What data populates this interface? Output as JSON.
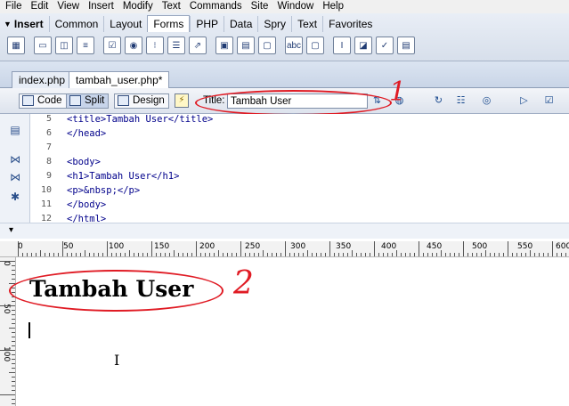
{
  "menu": [
    "File",
    "Edit",
    "View",
    "Insert",
    "Modify",
    "Text",
    "Commands",
    "Site",
    "Window",
    "Help"
  ],
  "insert_bar": {
    "label": "Insert",
    "tabs": [
      {
        "label": "Common",
        "active": false
      },
      {
        "label": "Layout",
        "active": false
      },
      {
        "label": "Forms",
        "active": true
      },
      {
        "label": "PHP",
        "active": false
      },
      {
        "label": "Data",
        "active": false
      },
      {
        "label": "Spry",
        "active": false
      },
      {
        "label": "Text",
        "active": false
      },
      {
        "label": "Favorites",
        "active": false
      }
    ],
    "icon_names": [
      "form-icon",
      "text-field-icon",
      "hidden-field-icon",
      "textarea-icon",
      "checkbox-icon",
      "radio-button-icon",
      "radio-group-icon",
      "list-menu-icon",
      "jump-menu-icon",
      "image-field-icon",
      "file-field-icon",
      "button-icon",
      "label-icon",
      "fieldset-icon",
      "spry-textfield-icon",
      "spry-select-icon",
      "spry-checkbox-icon",
      "spry-textarea-icon"
    ]
  },
  "doc_tabs": [
    "index.php",
    "tambah_user.php*"
  ],
  "doc_toolbar": {
    "view_buttons": [
      "Code",
      "Split",
      "Design"
    ],
    "active_view": "Split",
    "title_label": "Title:",
    "title_value": "Tambah User"
  },
  "code": {
    "line_numbers": [
      "5",
      "6",
      "7",
      "8",
      "9",
      "10",
      "11",
      "12"
    ],
    "lines": [
      "<title>Tambah User</title>",
      "</head>",
      "",
      "<body>",
      "<h1>Tambah User</h1>",
      "<p>&nbsp;</p>",
      "</body>",
      "</html>"
    ]
  },
  "ruler": {
    "top_labels": [
      "0",
      "50",
      "100",
      "150",
      "200",
      "250",
      "300",
      "350",
      "400",
      "450",
      "500",
      "550",
      "600"
    ],
    "left_labels": [
      "0",
      "50",
      "100"
    ]
  },
  "design": {
    "heading": "Tambah User"
  },
  "annotations": [
    "1",
    "2"
  ],
  "colors": {
    "annotation": "#e01b24",
    "code": "#00008b"
  }
}
